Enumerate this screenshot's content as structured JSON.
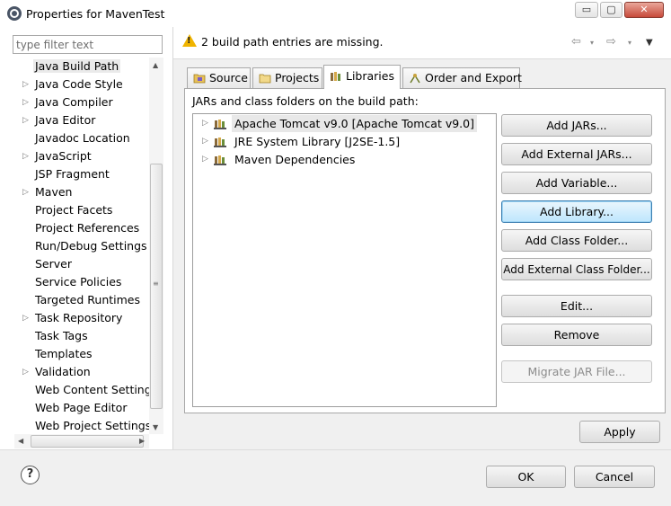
{
  "window": {
    "title": "Properties for MavenTest",
    "minimize_glyph": "▭",
    "maximize_glyph": "▢",
    "close_glyph": "✕"
  },
  "sidebar": {
    "filter_placeholder": "type filter text",
    "items": [
      {
        "label": "Java Build Path",
        "has_children": false,
        "selected": true
      },
      {
        "label": "Java Code Style",
        "has_children": true
      },
      {
        "label": "Java Compiler",
        "has_children": true
      },
      {
        "label": "Java Editor",
        "has_children": true
      },
      {
        "label": "Javadoc Location",
        "has_children": false
      },
      {
        "label": "JavaScript",
        "has_children": true
      },
      {
        "label": "JSP Fragment",
        "has_children": false
      },
      {
        "label": "Maven",
        "has_children": true
      },
      {
        "label": "Project Facets",
        "has_children": false
      },
      {
        "label": "Project References",
        "has_children": false
      },
      {
        "label": "Run/Debug Settings",
        "has_children": false
      },
      {
        "label": "Server",
        "has_children": false
      },
      {
        "label": "Service Policies",
        "has_children": false
      },
      {
        "label": "Targeted Runtimes",
        "has_children": false
      },
      {
        "label": "Task Repository",
        "has_children": true
      },
      {
        "label": "Task Tags",
        "has_children": false
      },
      {
        "label": "Templates",
        "has_children": false
      },
      {
        "label": "Validation",
        "has_children": true
      },
      {
        "label": "Web Content Settings",
        "has_children": false
      },
      {
        "label": "Web Page Editor",
        "has_children": false
      },
      {
        "label": "Web Project Settings",
        "has_children": false
      }
    ]
  },
  "message": {
    "text": "2 build path entries are missing.",
    "icon": "warning-icon"
  },
  "tabs": [
    {
      "label": "Source",
      "icon": "source-folder-icon"
    },
    {
      "label": "Projects",
      "icon": "projects-icon"
    },
    {
      "label": "Libraries",
      "icon": "library-icon",
      "active": true
    },
    {
      "label": "Order and Export",
      "icon": "order-export-icon"
    }
  ],
  "libraries": {
    "heading": "JARs and class folders on the build path:",
    "entries": [
      {
        "label": "Apache Tomcat v9.0 [Apache Tomcat v9.0]",
        "selected": true
      },
      {
        "label": "JRE System Library [J2SE-1.5]"
      },
      {
        "label": "Maven Dependencies"
      }
    ]
  },
  "buttons": {
    "add_jars": "Add JARs...",
    "add_external_jars": "Add External JARs...",
    "add_variable": "Add Variable...",
    "add_library": "Add Library...",
    "add_class_folder": "Add Class Folder...",
    "add_external_class_folder": "Add External Class Folder...",
    "edit": "Edit...",
    "remove": "Remove",
    "migrate_jar": "Migrate JAR File...",
    "apply": "Apply",
    "ok": "OK",
    "cancel": "Cancel"
  },
  "colors": {
    "focus_border": "#3c7fb1",
    "warning": "#f0b400",
    "disabled_text": "#8c8c8c"
  }
}
